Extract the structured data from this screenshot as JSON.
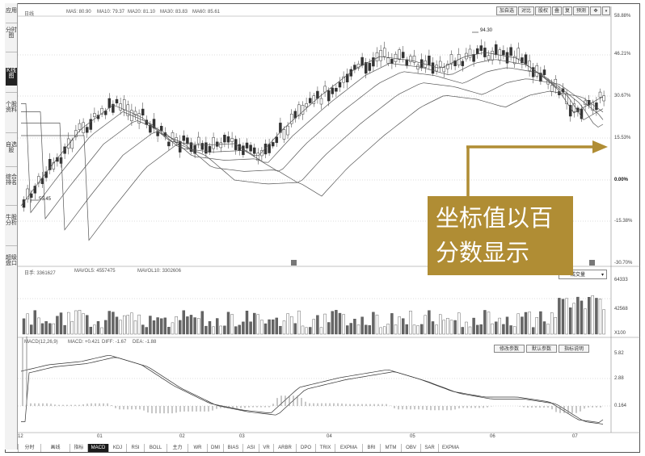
{
  "sidebar": {
    "items": [
      {
        "label": "应用",
        "active": false
      },
      {
        "label": "分时图",
        "active": false
      },
      {
        "label": "K线图",
        "active": true
      },
      {
        "label": "个股资料",
        "active": false
      },
      {
        "label": "自选股",
        "active": false
      },
      {
        "label": "综合排名",
        "active": false
      },
      {
        "label": "牛股分析",
        "active": false
      },
      {
        "label": "超级盘口",
        "active": false
      }
    ]
  },
  "price_panel": {
    "ma_header": [
      "日线",
      "MA5: 80.90",
      "MA10: 79.37",
      "MA20: 81.10",
      "MA30: 83.83",
      "MA60: 85.61"
    ],
    "y_labels": [
      "58.88%",
      "46.21%",
      "30.67%",
      "15.53%",
      "0.00%",
      "-15.38%",
      "-30.70%"
    ],
    "high_label": "94.30",
    "low_label": "55.45",
    "toolbar": [
      "加自选",
      "对比",
      "股权",
      "叠",
      "复",
      "预测",
      "✥"
    ]
  },
  "volume_panel": {
    "header": [
      "日手: 3361627",
      "MAVOL5: 4557475",
      "MAVOL10: 3302606"
    ],
    "y_labels": [
      "64333",
      "42568",
      "X100"
    ],
    "dropdown": "成交量"
  },
  "macd_panel": {
    "header": [
      "MACD(12,26,9)",
      "MACD: +0.421",
      "DIFF: -1.67",
      "DEA: -1.88"
    ],
    "buttons": [
      "修改参数",
      "默认参数",
      "指标说明"
    ],
    "y_labels": [
      "5.82",
      "2.88",
      "0.164"
    ]
  },
  "x_axis": {
    "ticks": [
      "12",
      "01",
      "02",
      "03",
      "04",
      "05",
      "06",
      "07"
    ]
  },
  "indicator_tabs": [
    "分时",
    "画线",
    "指标",
    "MACD",
    "KDJ",
    "RSI",
    "BOLL",
    "主力",
    "WR",
    "DMI",
    "BIAS",
    "ASI",
    "VR",
    "ARBR",
    "DPO",
    "TRIX",
    "EXPMA",
    "BRI",
    "MTM",
    "OBV",
    "SAR",
    "EXPMA"
  ],
  "callout": {
    "line1": "坐标值以百",
    "line2": "分数显示"
  },
  "colors": {
    "callout_bg": "#b08d34",
    "arrow": "#b08d34",
    "candle": "#333333",
    "ma_line": "#555555"
  }
}
